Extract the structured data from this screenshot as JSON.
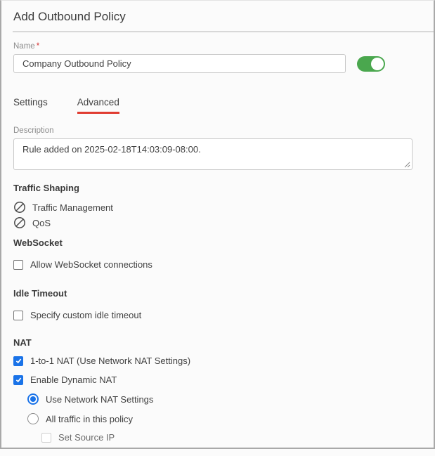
{
  "page": {
    "title": "Add Outbound Policy"
  },
  "name_field": {
    "label": "Name",
    "required_marker": "*",
    "value": "Company Outbound Policy",
    "toggle_on": true
  },
  "tabs": [
    {
      "label": "Settings",
      "active": false
    },
    {
      "label": "Advanced",
      "active": true
    }
  ],
  "description_field": {
    "label": "Description",
    "value": "Rule added on 2025-02-18T14:03:09-08:00."
  },
  "sections": {
    "traffic_shaping": {
      "heading": "Traffic Shaping",
      "items": [
        {
          "icon": "no-entry-icon",
          "label": "Traffic Management"
        },
        {
          "icon": "no-entry-icon",
          "label": "QoS"
        }
      ]
    },
    "websocket": {
      "heading": "WebSocket",
      "checkbox": {
        "label": "Allow WebSocket connections",
        "checked": false
      }
    },
    "idle_timeout": {
      "heading": "Idle Timeout",
      "checkbox": {
        "label": "Specify custom idle timeout",
        "checked": false
      }
    },
    "nat": {
      "heading": "NAT",
      "one_to_one": {
        "label": "1-to-1 NAT (Use Network NAT Settings)",
        "checked": true
      },
      "dynamic": {
        "label": "Enable Dynamic NAT",
        "checked": true
      },
      "radio_network": {
        "label": "Use Network NAT Settings",
        "selected": true
      },
      "radio_all_traffic": {
        "label": "All traffic in this policy",
        "selected": false
      },
      "set_source_ip": {
        "label": "Set Source IP",
        "checked": false,
        "disabled": true
      }
    }
  },
  "colors": {
    "accent_blue": "#1a73e8",
    "toggle_green": "#4aa74e",
    "tab_underline_red": "#e03c31",
    "required_red": "#d32f2f"
  }
}
